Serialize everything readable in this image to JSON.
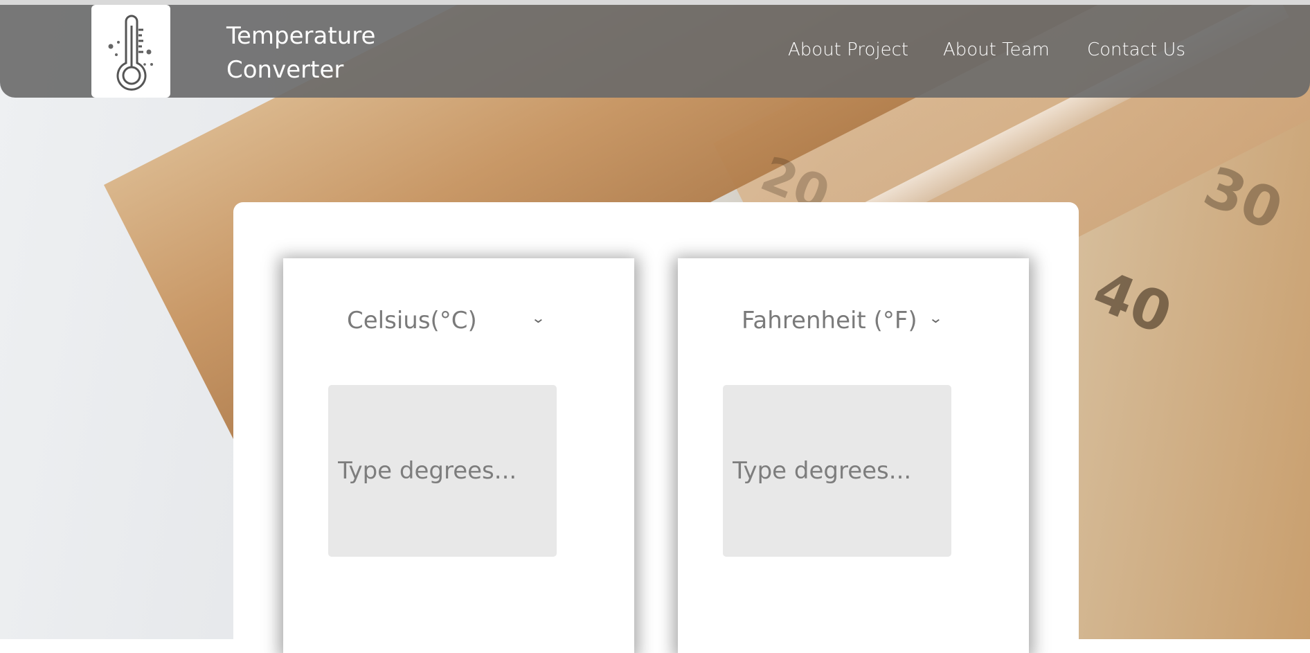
{
  "header": {
    "brand_line1": "Temperature",
    "brand_line2": "Converter",
    "logo_icon": "thermometer-icon",
    "nav": {
      "about_project": "About Project",
      "about_team": "About Team",
      "contact_us": "Contact Us"
    }
  },
  "converter": {
    "left": {
      "unit": "Celsius(°C)",
      "input_placeholder": "Type degrees...",
      "input_value": ""
    },
    "right": {
      "unit": "Fahrenheit (°F)",
      "input_placeholder": "Type degrees...",
      "input_value": ""
    },
    "chevron_icon": "chevron-down-icon"
  },
  "background": {
    "scale_numbers": [
      "40",
      "30",
      "20"
    ]
  },
  "colors": {
    "navbar": "#696969",
    "input_bg": "#e8e8e8",
    "text_gray": "#7a7a7a"
  }
}
